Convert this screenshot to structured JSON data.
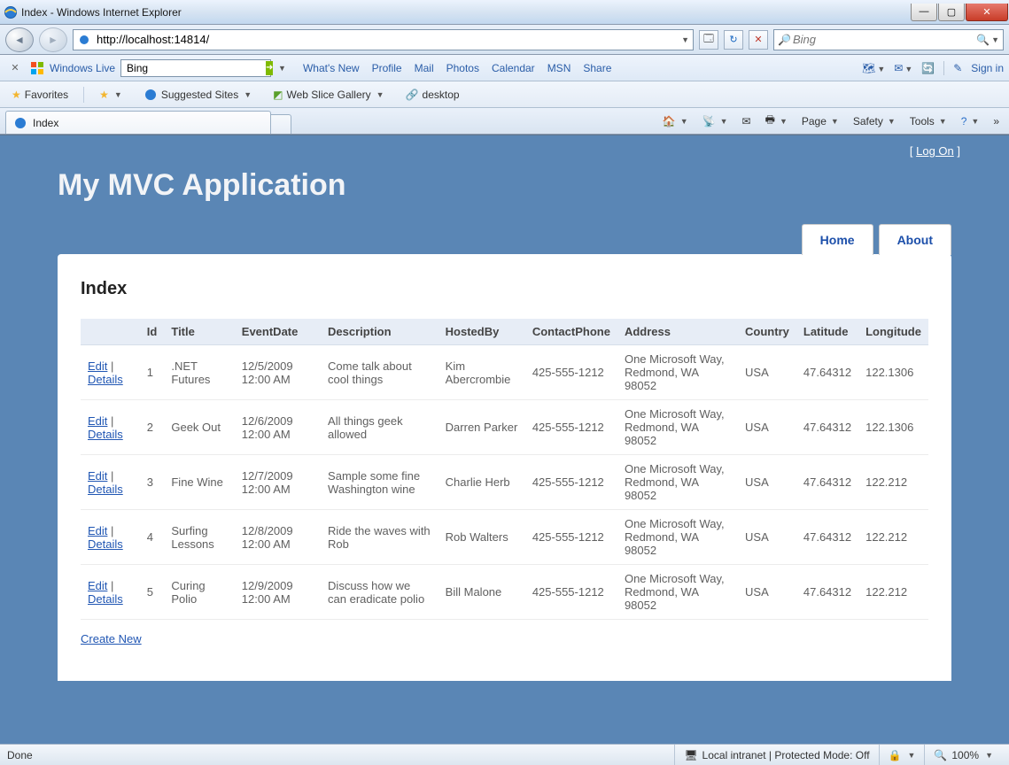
{
  "window": {
    "title": "Index - Windows Internet Explorer",
    "sign_in": "Sign in",
    "min_tip": "Minimize",
    "max_tip": "Maximize",
    "close_tip": "Close"
  },
  "addressbar": {
    "url": "http://localhost:14814/",
    "search_placeholder": "Bing"
  },
  "windows_live": {
    "brand": "Windows Live",
    "search": "Bing",
    "links": [
      "What's New",
      "Profile",
      "Mail",
      "Photos",
      "Calendar",
      "MSN",
      "Share"
    ]
  },
  "favorites": {
    "label": "Favorites",
    "suggested": "Suggested Sites",
    "webslice": "Web Slice Gallery",
    "desktop": "desktop"
  },
  "tab": {
    "title": "Index"
  },
  "commandbar": {
    "page": "Page",
    "safety": "Safety",
    "tools": "Tools"
  },
  "app": {
    "title": "My MVC Application",
    "logon": "Log On",
    "home": "Home",
    "about": "About",
    "page_heading": "Index",
    "actions": {
      "edit": "Edit",
      "details": "Details"
    },
    "create_link": "Create New",
    "headers": [
      "",
      "Id",
      "Title",
      "EventDate",
      "Description",
      "HostedBy",
      "ContactPhone",
      "Address",
      "Country",
      "Latitude",
      "Longitude"
    ],
    "rows": [
      {
        "id": "1",
        "title": ".NET Futures",
        "eventdate": "12/5/2009 12:00 AM",
        "description": "Come talk about cool things",
        "hostedby": "Kim Abercrombie",
        "phone": "425-555-1212",
        "address": "One Microsoft Way, Redmond, WA 98052",
        "country": "USA",
        "lat": "47.64312",
        "lng": "122.1306"
      },
      {
        "id": "2",
        "title": "Geek Out",
        "eventdate": "12/6/2009 12:00 AM",
        "description": "All things geek allowed",
        "hostedby": "Darren Parker",
        "phone": "425-555-1212",
        "address": "One Microsoft Way, Redmond, WA 98052",
        "country": "USA",
        "lat": "47.64312",
        "lng": "122.1306"
      },
      {
        "id": "3",
        "title": "Fine Wine",
        "eventdate": "12/7/2009 12:00 AM",
        "description": "Sample some fine Washington wine",
        "hostedby": "Charlie Herb",
        "phone": "425-555-1212",
        "address": "One Microsoft Way, Redmond, WA 98052",
        "country": "USA",
        "lat": "47.64312",
        "lng": "122.212"
      },
      {
        "id": "4",
        "title": "Surfing Lessons",
        "eventdate": "12/8/2009 12:00 AM",
        "description": "Ride the waves with Rob",
        "hostedby": "Rob Walters",
        "phone": "425-555-1212",
        "address": "One Microsoft Way, Redmond, WA 98052",
        "country": "USA",
        "lat": "47.64312",
        "lng": "122.212"
      },
      {
        "id": "5",
        "title": "Curing Polio",
        "eventdate": "12/9/2009 12:00 AM",
        "description": "Discuss how we can eradicate polio",
        "hostedby": "Bill Malone",
        "phone": "425-555-1212",
        "address": "One Microsoft Way, Redmond, WA 98052",
        "country": "USA",
        "lat": "47.64312",
        "lng": "122.212"
      }
    ]
  },
  "statusbar": {
    "done": "Done",
    "zone": "Local intranet | Protected Mode: Off",
    "zoom": "100%"
  }
}
